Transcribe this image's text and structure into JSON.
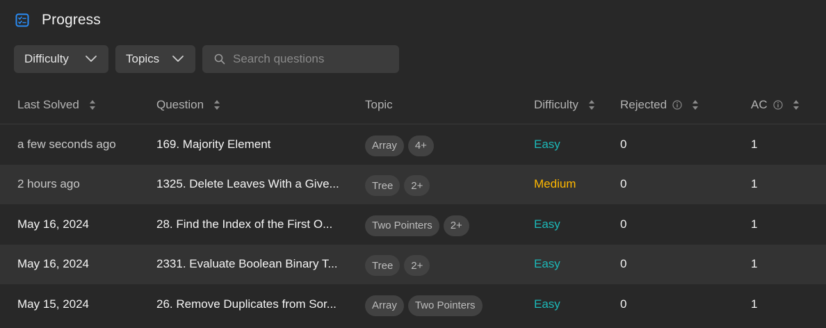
{
  "header": {
    "title": "Progress",
    "icon": "checklist-icon",
    "accent": "#2a8cf5"
  },
  "filters": {
    "difficulty_label": "Difficulty",
    "topics_label": "Topics",
    "search_placeholder": "Search questions"
  },
  "columns": {
    "last_solved": "Last Solved",
    "question": "Question",
    "topic": "Topic",
    "difficulty": "Difficulty",
    "rejected": "Rejected",
    "ac": "AC"
  },
  "colors": {
    "easy": "#1cb8b8",
    "medium": "#ffb800"
  },
  "rows": [
    {
      "last_solved": "a few seconds ago",
      "question": "169. Majority Element",
      "tags": [
        "Array",
        "4+"
      ],
      "difficulty": "Easy",
      "rejected": "0",
      "ac": "1"
    },
    {
      "last_solved": "2 hours ago",
      "question": "1325. Delete Leaves With a Give...",
      "tags": [
        "Tree",
        "2+"
      ],
      "difficulty": "Medium",
      "rejected": "0",
      "ac": "1"
    },
    {
      "last_solved": "May 16, 2024",
      "question": "28. Find the Index of the First O...",
      "tags": [
        "Two Pointers",
        "2+"
      ],
      "difficulty": "Easy",
      "rejected": "0",
      "ac": "1"
    },
    {
      "last_solved": "May 16, 2024",
      "question": "2331. Evaluate Boolean Binary T...",
      "tags": [
        "Tree",
        "2+"
      ],
      "difficulty": "Easy",
      "rejected": "0",
      "ac": "1"
    },
    {
      "last_solved": "May 15, 2024",
      "question": "26. Remove Duplicates from Sor...",
      "tags": [
        "Array",
        "Two Pointers"
      ],
      "difficulty": "Easy",
      "rejected": "0",
      "ac": "1"
    }
  ]
}
